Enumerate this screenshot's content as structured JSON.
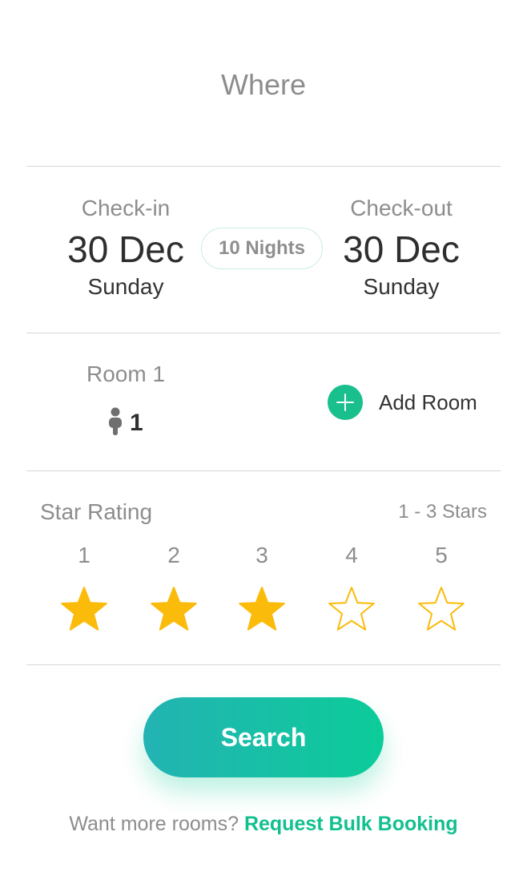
{
  "where": {
    "label": "Where"
  },
  "check_in": {
    "label": "Check-in",
    "date": "30 Dec",
    "day": "Sunday"
  },
  "check_out": {
    "label": "Check-out",
    "date": "30 Dec",
    "day": "Sunday"
  },
  "nights": {
    "label": "10 Nights"
  },
  "room": {
    "label": "Room 1",
    "guest_count": "1",
    "add_room_label": "Add Room",
    "icon": "person-icon"
  },
  "star_rating": {
    "label": "Star Rating",
    "range": "1 - 3 Stars",
    "selected_max": 3,
    "stars": [
      {
        "number": "1",
        "filled": true
      },
      {
        "number": "2",
        "filled": true
      },
      {
        "number": "3",
        "filled": true
      },
      {
        "number": "4",
        "filled": false
      },
      {
        "number": "5",
        "filled": false
      }
    ]
  },
  "search": {
    "label": "Search"
  },
  "footer": {
    "text": "Want more rooms?",
    "link": "Request Bulk Booking"
  },
  "colors": {
    "accent": "#12c08f",
    "star": "#fbbb0a",
    "gradient_start": "#23b3b3",
    "gradient_end": "#0ccc99"
  }
}
